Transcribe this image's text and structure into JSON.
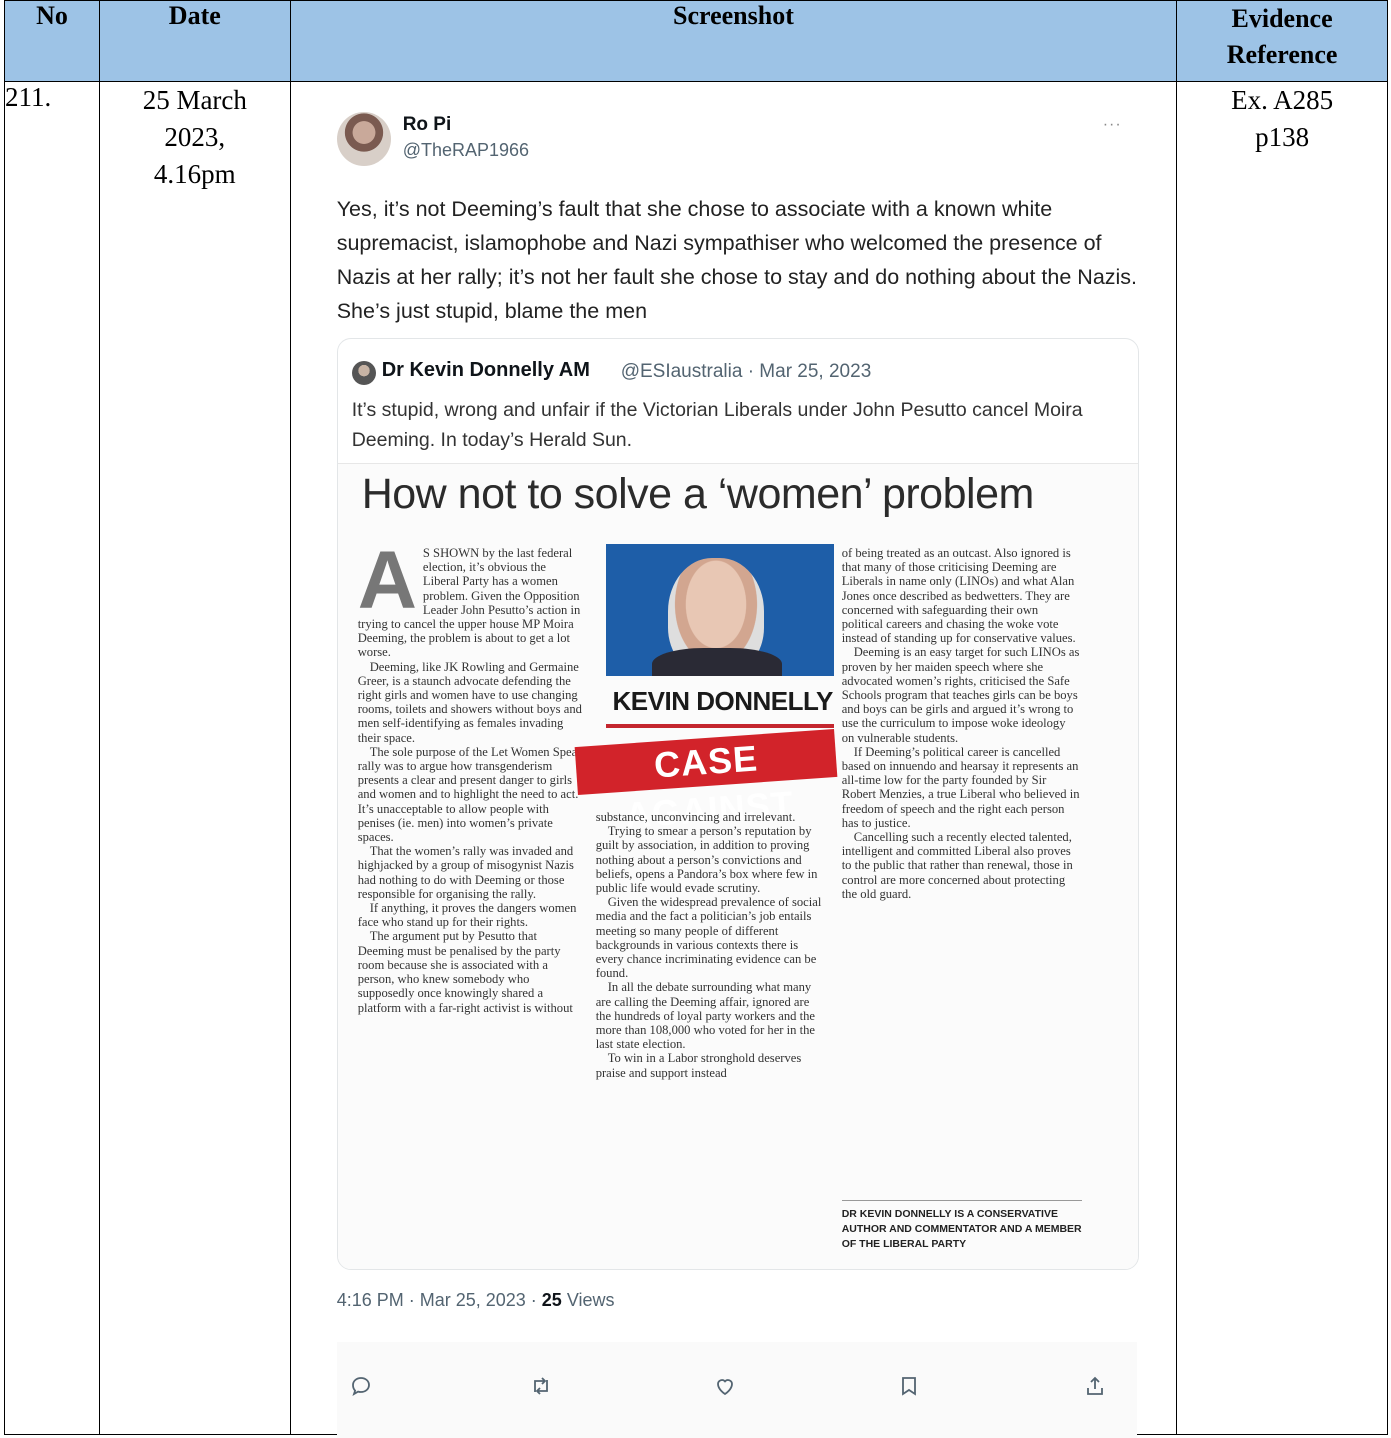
{
  "table": {
    "headers": {
      "no": "No",
      "date": "Date",
      "screenshot": "Screenshot",
      "evidence_line1": "Evidence",
      "evidence_line2": "Reference"
    },
    "row": {
      "no": "211.",
      "date_line1": "25 March",
      "date_line2": "2023,",
      "date_line3": "4.16pm",
      "ref_line1": "Ex. A285",
      "ref_line2": "p138"
    }
  },
  "tweet": {
    "display_name": "Ro Pi",
    "handle": "@TheRAP1966",
    "more": "···",
    "text": "Yes, it’s not Deeming’s fault that she chose to associate with a known white supremacist, islamophobe and Nazi sympathiser who welcomed the presence of Nazis at her rally; it’s not her fault she chose to stay and do nothing about the Nazis. She’s just stupid, blame the men",
    "timestamp": "4:16 PM · Mar 25, 2023 · ",
    "views_count": "25",
    "views_label": " Views",
    "icons": [
      "reply-icon",
      "retweet-icon",
      "like-icon",
      "bookmark-icon",
      "share-icon"
    ]
  },
  "quoted": {
    "name": "Dr Kevin Donnelly AM",
    "meta": "@ESIaustralia · Mar 25, 2023",
    "text": "It’s stupid, wrong and unfair if the Victorian Liberals under John Pesutto cancel Moira Deeming. In today’s Herald Sun."
  },
  "article": {
    "headline": "How not to solve a ‘women’ problem",
    "byline": "KEVIN DONNELLY",
    "banner": "CASE AGAINST",
    "dropcap": "A",
    "col1": [
      "S SHOWN by the last federal election, it’s obvious the Liberal Party has a women problem. Given the Opposition Leader John Pesutto’s action in trying to cancel the upper house MP Moira Deeming, the problem is about to get a lot worse.",
      "Deeming, like JK Rowling and Germaine Greer, is a staunch advocate defending the right girls and women have to use changing rooms, toilets and showers without boys and men self-identifying as females invading their space.",
      "The sole purpose of the Let Women Speak rally was to argue how transgenderism presents a clear and present danger to girls and women and to highlight the need to act. It’s unacceptable to allow people with penises (ie. men) into women’s private spaces.",
      "That the women’s rally was invaded and highjacked by a group of misogynist Nazis had nothing to do with Deeming or those responsible for organising the rally.",
      "If anything, it proves the dangers women face who stand up for their rights.",
      "The argument put by Pesutto that Deeming must be penalised by the party room because she is associated with a person, who knew somebody who supposedly once knowingly shared a platform with a far-right activist is without"
    ],
    "col2": [
      "substance, unconvincing and irrelevant.",
      "Trying to smear a person’s reputation by guilt by association, in addition to proving nothing about a person’s convictions and beliefs, opens a Pandora’s box where few in public life would evade scrutiny.",
      "Given the widespread prevalence of social media and the fact a politician’s job entails meeting so many people of different backgrounds in various contexts there is every chance incriminating evidence can be found.",
      "In all the debate surrounding what many are calling the Deeming affair, ignored are the hundreds of loyal party workers and the more than 108,000 who voted for her in the last state election.",
      "To win in a Labor stronghold deserves praise and support instead"
    ],
    "col3": [
      "of being treated as an outcast. Also ignored is that many of those criticising Deeming are Liberals in name only (LINOs) and what Alan Jones once described as bedwetters. They are concerned with safeguarding their own political careers and chasing the woke vote instead of standing up for conservative values.",
      "Deeming is an easy target for such LINOs as proven by her maiden speech where she advocated women’s rights, criticised the Safe Schools program that teaches girls can be boys and boys can be girls and argued it’s wrong to use the curriculum to impose woke ideology on vulnerable students.",
      "If Deeming’s political career is cancelled based on innuendo and hearsay it represents an all-time low for the party founded by Sir Robert Menzies, a true Liberal who believed in freedom of speech and the right each person has to justice.",
      "Cancelling such a recently elected talented, intelligent and committed Liberal also proves to the public that rather than renewal, those in control are more concerned about protecting the old guard."
    ],
    "author_note": "DR KEVIN DONNELLY IS A CONSERVATIVE AUTHOR AND COMMENTATOR AND A MEMBER OF THE LIBERAL PARTY"
  }
}
